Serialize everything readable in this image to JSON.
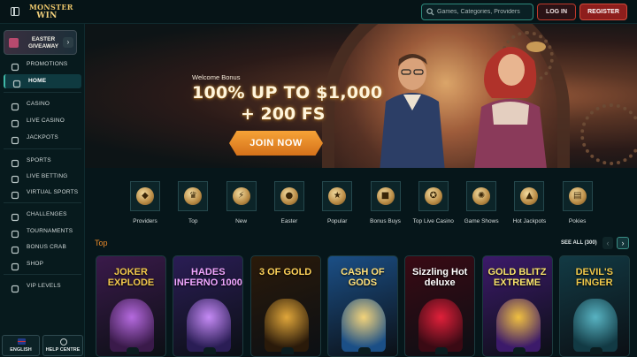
{
  "header": {
    "logo_line1": "MONSTER",
    "logo_line2": "WIN",
    "search_placeholder": "Games, Categories, Providers",
    "login_label": "LOG IN",
    "register_label": "REGISTER"
  },
  "sidebar": {
    "giveaway_label": "EASTER GIVEAWAY",
    "items": [
      {
        "label": "PROMOTIONS",
        "icon": "gift-icon"
      },
      {
        "label": "HOME",
        "icon": "home-icon",
        "active": true
      },
      {
        "label": "CASINO",
        "icon": "cards-icon"
      },
      {
        "label": "LIVE CASINO",
        "icon": "live-icon"
      },
      {
        "label": "JACKPOTS",
        "icon": "jackpot-icon"
      },
      {
        "label": "SPORTS",
        "icon": "ball-icon"
      },
      {
        "label": "LIVE BETTING",
        "icon": "live-betting-icon"
      },
      {
        "label": "VIRTUAL SPORTS",
        "icon": "virtual-icon"
      },
      {
        "label": "CHALLENGES",
        "icon": "target-icon"
      },
      {
        "label": "TOURNAMENTS",
        "icon": "trophy-icon"
      },
      {
        "label": "BONUS CRAB",
        "icon": "crab-icon"
      },
      {
        "label": "SHOP",
        "icon": "cart-icon"
      },
      {
        "label": "VIP LEVELS",
        "icon": "diamond-icon"
      }
    ],
    "language_label": "ENGLISH",
    "help_label": "HELP CENTRE"
  },
  "hero": {
    "subtitle": "Welcome Bonus",
    "title_line1": "100% UP TO $1,000",
    "title_line2": "+ 200 FS",
    "cta_label": "JOIN NOW"
  },
  "categories": [
    {
      "label": "Providers",
      "icon": "providers-icon",
      "glyph": "◆"
    },
    {
      "label": "Top",
      "icon": "crown-icon",
      "glyph": "♛"
    },
    {
      "label": "New",
      "icon": "lightning-icon",
      "glyph": "⚡"
    },
    {
      "label": "Easter",
      "icon": "egg-icon",
      "glyph": "●"
    },
    {
      "label": "Popular",
      "icon": "star-icon",
      "glyph": "★"
    },
    {
      "label": "Bonus Buys",
      "icon": "chest-icon",
      "glyph": "■"
    },
    {
      "label": "Top Live Casino",
      "icon": "chip-icon",
      "glyph": "✪"
    },
    {
      "label": "Game Shows",
      "icon": "wheel-icon",
      "glyph": "✺"
    },
    {
      "label": "Hot Jackpots",
      "icon": "ship-icon",
      "glyph": "▲"
    },
    {
      "label": "Pokies",
      "icon": "slot-machine-icon",
      "glyph": "▤"
    }
  ],
  "top_section": {
    "title": "Top",
    "see_all_label": "SEE ALL (300)"
  },
  "games": [
    {
      "name": "JOKER EXPLODE",
      "bg": "#3a1a4a",
      "accent": "#b56adf",
      "text_color": "#f2c94c"
    },
    {
      "name": "HADES INFERNO 1000",
      "bg": "#2a1d55",
      "accent": "#c58af5",
      "text_color": "#f0a6ff"
    },
    {
      "name": "3 OF GOLD",
      "bg": "#2a1a0a",
      "accent": "#e0a63a",
      "text_color": "#ffd35a"
    },
    {
      "name": "CASH OF GODS",
      "bg": "#1b4f86",
      "accent": "#f3d37a",
      "text_color": "#ffe07a"
    },
    {
      "name": "Sizzling Hot deluxe",
      "bg": "#3a0a14",
      "accent": "#e0203a",
      "text_color": "#ffffff"
    },
    {
      "name": "GOLD BLITZ EXTREME",
      "bg": "#3c1a6a",
      "accent": "#f0c040",
      "text_color": "#f7e26b"
    },
    {
      "name": "DEVIL'S FINGER",
      "bg": "#123a44",
      "accent": "#58b3c2",
      "text_color": "#f0c84a"
    }
  ]
}
